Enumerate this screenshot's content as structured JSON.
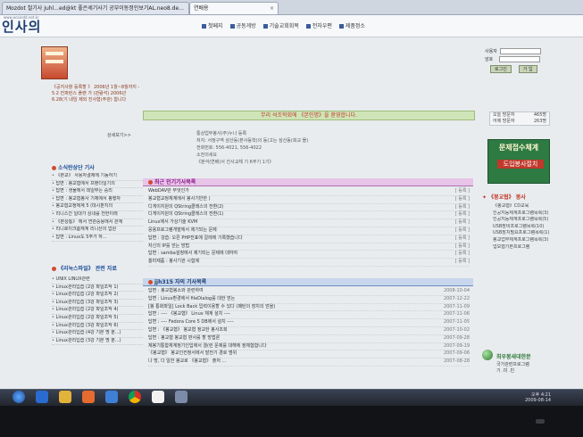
{
  "tabs": [
    {
      "label": "Mozdot 철기사 Juhl...ed@kt 좋은세기사기 공부이동정인보기AL.neo8.de...",
      "active": false
    },
    {
      "label": "연배용",
      "active": true
    }
  ],
  "header": {
    "logo": "인사의",
    "url_small": "www.ecoindd.net.kr",
    "nav": [
      "첫페지",
      "공동게방",
      "기술교회회목",
      "전자우편",
      "제품정소"
    ]
  },
  "login": {
    "id_label": "사용자",
    "pw_label": "암호",
    "login_btn": "로그인",
    "join_btn": "가 입"
  },
  "notice": "《공지사항 등록할 》 2006년 1월~8월까지 - 5.2 컨퍼런스 플랜 가 (관람석) 2006년 6.28(기 내임 제외 진사협(주관) 합니다",
  "more_label": "상세보기>>",
  "welcome": "무리 석조학회에 《본인명》을 환영합니다.",
  "info": [
    "통상업무봉사(주)누나 등록",
    "처지: 서정구역 삼산동(본사동학)의 동(고는 삼산동(회교 몰)",
    "전화번호: 556-4021, 556-4022",
    "소전의세요",
    "《분석(연배)서 진사교체 기 6주기 1기》"
  ],
  "stats": [
    {
      "label": "오늘 방문자",
      "value": "465명"
    },
    {
      "label": "어제 방문자",
      "value": "263명"
    }
  ],
  "banner": {
    "title": "문제접수체계",
    "sub": "도입봉사절치"
  },
  "left_section1": {
    "title": "소식란상단 기사",
    "items": [
      "《본교》 사용자결제에 기동하기",
      "답변 : 봉교협에서 프랜더일기의",
      "답변 : 생물에서 데일부는 중리",
      "답변 : 봉교협봉사 기체에서 봉행자",
      "봉교협교정체계 5 (데시판지의",
      "리니스간 일대가 상내를 전한이래",
      "《본상통》 에서 연관중용에서 관계",
      "리니로이크롬체계 리니산의 업원",
      "답변 : Linux도 5주가 하..."
    ]
  },
  "left_section2": {
    "title": "《리눅스파일》 관련 자료",
    "items": [
      "UNIX LINUX관련",
      "Linux관리입습 (2강 파일조작 1)",
      "Linux관리입습 (2강 파일조작 2)",
      "Linux관리입습 (3강 파일조작 3)",
      "Linux관리입습 (2강 파일조작 4)",
      "Linux관리입습 (2강 파일조작 5)",
      "Linux관리입습 (3강 파일조작 6)",
      "Linux관리입습 (4강 기본 명 분...)",
      "Linux관리입습 (3강 기본 명 분...)"
    ]
  },
  "panel1": {
    "title": "최근 인기기사목록",
    "rows": [
      {
        "title": "WebDAV란 무엇인가",
        "date": "[ 등록 ]"
      },
      {
        "title": "봉교협교정체계에서 봉사기반한 )",
        "date": "[ 등록 ]"
      },
      {
        "title": "디게이지원의 QString클래스의 전환(2)",
        "date": "[ 등록 ]"
      },
      {
        "title": "디게이지원의 QString클래스의 전환(1)",
        "date": "[ 등록 ]"
      },
      {
        "title": "Linux에서 가상기술 KVM",
        "date": "[ 등록 ]"
      },
      {
        "title": "응용프로그램개발에서 제기되는 문제",
        "date": "[ 등록 ]"
      },
      {
        "title": "답변 : 강습: 오픈 PHP전표에 갈레에 기록했습니다",
        "date": "[ 등록 ]"
      },
      {
        "title": "자신의 IP를 얻는 방법",
        "date": "[ 등록 ]"
      },
      {
        "title": "답변 : samba설정에서 제기되는 문제에 대하여",
        "date": "[ 등록 ]"
      },
      {
        "title": "흥미제품 : 봉사기관 시험에",
        "date": "[ 등록 ]"
      }
    ]
  },
  "panel2": {
    "title": "jjh315 자의 기사목록",
    "rows": [
      {
        "title": "답변 : 봉교협봉소와 관련하여",
        "date": "2008-10-04"
      },
      {
        "title": "답변 : Linux환경에서 fileDialog를 대한 얻는",
        "date": "2007-12-22"
      },
      {
        "title": "[봉 통화파일] Lock Back 입력이용할 수 있다 (패턴의 장치의 얻을)",
        "date": "2007-11-09"
      },
      {
        "title": "답변 : ---- 《봉교협》 Linux 체계 설치 ----",
        "date": "2007-11-06"
      },
      {
        "title": "답변 : ---- Fedora Core 5 DB에서 설치 ----",
        "date": "2007-11-05"
      },
      {
        "title": "답변 : 《봉교협》 봉교협 정교한 봉사조회",
        "date": "2007-10-02"
      },
      {
        "title": "답변 : 봉교협 봉교협 판사를 할 방법론",
        "date": "2007-09-28"
      },
      {
        "title": "제봉기통합체계정기인입에서 결(런 문제를 대해에 정체협합니다",
        "date": "2007-09-19"
      },
      {
        "title": "《봉교협》 봉교인컨정서에서 발전기 경로 범위",
        "date": "2007-09-06"
      },
      {
        "title": "나 방, 다 일한 봉교로 《봉교협》 출처 ...",
        "date": "2007-08-28"
      }
    ]
  },
  "right_section": {
    "title": "《봉교협》 봉사",
    "items": [
      "《봉교협》CD교육",
      "인공지능체계프로그램목록(3)",
      "인공지능체계프로그램목록(5)",
      "USB장비프로그램목록(10)",
      "USB장치필요프로그램목록(1)",
      "봉교업무체계프로그램목록(3)",
      "업모협기본프로그램"
    ]
  },
  "globe_section": {
    "title": "최우봉새대한문",
    "items": [
      "국가관련프로그램",
      "기 .미 .빈"
    ]
  },
  "taskbar": {
    "icons": [
      "windows-start",
      "explorer",
      "folder",
      "media",
      "mail",
      "chrome",
      "document",
      "settings"
    ],
    "tray_time": "오후 4:21",
    "tray_date": "2009-08-14"
  },
  "colors": {
    "accent_blue": "#1c4f9a",
    "welcome_green": "#cfe5b7",
    "panel_purple": "#e8c4e8",
    "banner_green": "#2d7a43"
  }
}
